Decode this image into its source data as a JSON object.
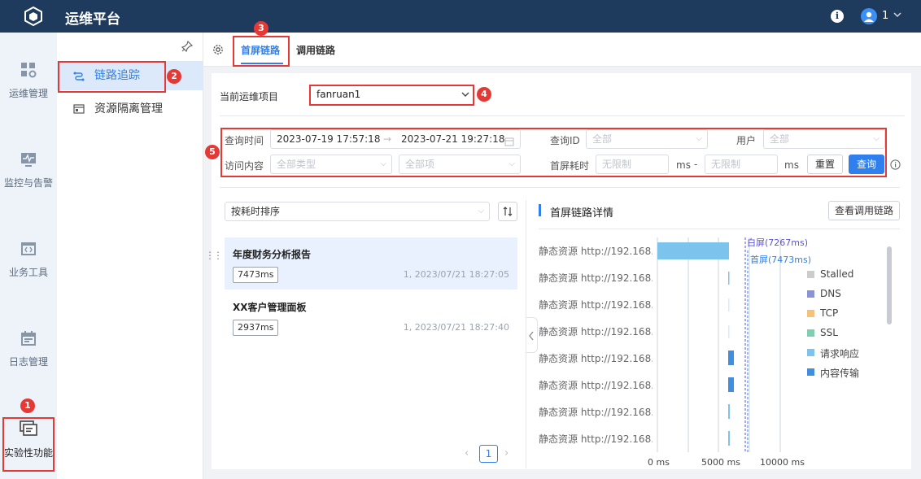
{
  "app": {
    "title": "运维平台",
    "user_label": "1"
  },
  "leftnav": {
    "items": [
      {
        "label": "运维管理",
        "icon": "grid-gear-icon"
      },
      {
        "label": "监控与告警",
        "icon": "monitor-pulse-icon"
      },
      {
        "label": "业务工具",
        "icon": "code-window-icon"
      },
      {
        "label": "日志管理",
        "icon": "calendar-icon"
      },
      {
        "label": "实验性功能",
        "icon": "stacked-windows-icon"
      }
    ]
  },
  "subnav": {
    "items": [
      {
        "label": "链路追踪",
        "icon": "link-trace-icon"
      },
      {
        "label": "资源隔离管理",
        "icon": "resource-isolation-icon"
      }
    ]
  },
  "tabs": {
    "first": "首屏链路",
    "second": "调用链路"
  },
  "project": {
    "label": "当前运维项目",
    "value": "fanruan1"
  },
  "filters": {
    "time_label": "查询时间",
    "start": "2023-07-19 17:57:18",
    "end": "2023-07-21 19:27:18",
    "arrow": "→",
    "queryid_label": "查询ID",
    "queryid_placeholder": "全部",
    "user_label": "用户",
    "user_placeholder": "全部",
    "content_label": "访问内容",
    "type_placeholder": "全部类型",
    "item_placeholder": "全部项",
    "cost_label": "首屏耗时",
    "min_placeholder": "无限制",
    "max_placeholder": "无限制",
    "ms_unit": "ms",
    "dash": "-",
    "reset": "重置",
    "query": "查询"
  },
  "list": {
    "sort_label": "按耗时排序",
    "items": [
      {
        "title": "年度财务分析报告",
        "ms": "7473ms",
        "date": "1, 2023/07/21 18:27:05"
      },
      {
        "title": "XX客户管理面板",
        "ms": "2937ms",
        "date": "1, 2023/07/21 18:27:40"
      }
    ],
    "page": "1"
  },
  "detail": {
    "title": "首屏链路详情",
    "view_button": "查看调用链路",
    "rows": [
      "静态资源 http://192.168....",
      "静态资源 http://192.168....",
      "静态资源 http://192.168....",
      "静态资源 http://192.168....",
      "静态资源 http://192.168....",
      "静态资源 http://192.168....",
      "静态资源 http://192.168....",
      "静态资源 http://192.168...."
    ],
    "markers": {
      "white": "白屏(7267ms)",
      "first": "首屏(7473ms)"
    },
    "legend": [
      {
        "name": "Stalled",
        "color": "#cccccc"
      },
      {
        "name": "DNS",
        "color": "#8a93d6"
      },
      {
        "name": "TCP",
        "color": "#f5c27a"
      },
      {
        "name": "SSL",
        "color": "#7fcfb0"
      },
      {
        "name": "请求响应",
        "color": "#7cc3ee"
      },
      {
        "name": "内容传输",
        "color": "#3f8fde"
      }
    ],
    "ticks": [
      "0 ms",
      "5000 ms",
      "10000 ms"
    ]
  },
  "badges": [
    "1",
    "2",
    "3",
    "4",
    "5"
  ]
}
